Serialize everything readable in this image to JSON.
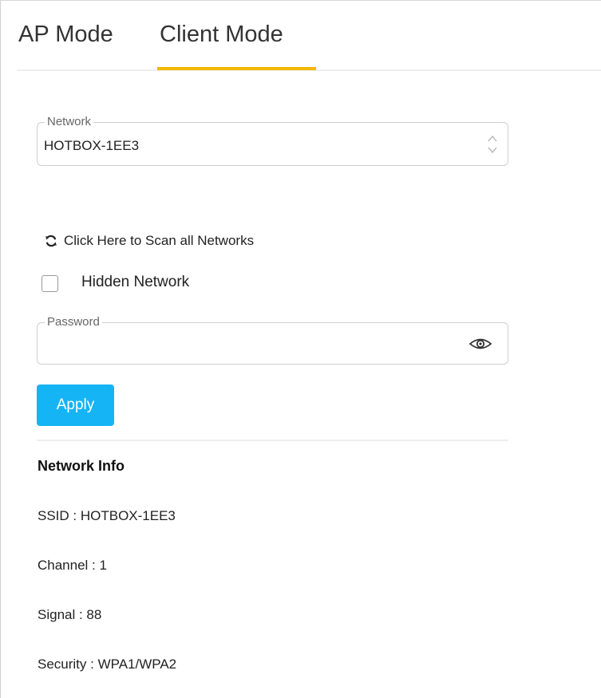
{
  "tabs": [
    {
      "label": "AP Mode",
      "active": false
    },
    {
      "label": "Client Mode",
      "active": true
    }
  ],
  "accent_color": "#f5b800",
  "network": {
    "legend": "Network",
    "value": "HOTBOX-1EE3"
  },
  "scan": {
    "icon": "refresh-icon",
    "label": "Click Here to Scan all Networks"
  },
  "hidden_network": {
    "label": "Hidden Network",
    "checked": false
  },
  "password": {
    "legend": "Password",
    "value": "",
    "toggle_icon": "eye-icon"
  },
  "apply": {
    "label": "Apply",
    "color": "#15b4f4"
  },
  "network_info": {
    "title": "Network Info",
    "ssid": "SSID : HOTBOX-1EE3",
    "channel": "Channel : 1",
    "signal": "Signal : 88",
    "security": "Security : WPA1/WPA2"
  }
}
